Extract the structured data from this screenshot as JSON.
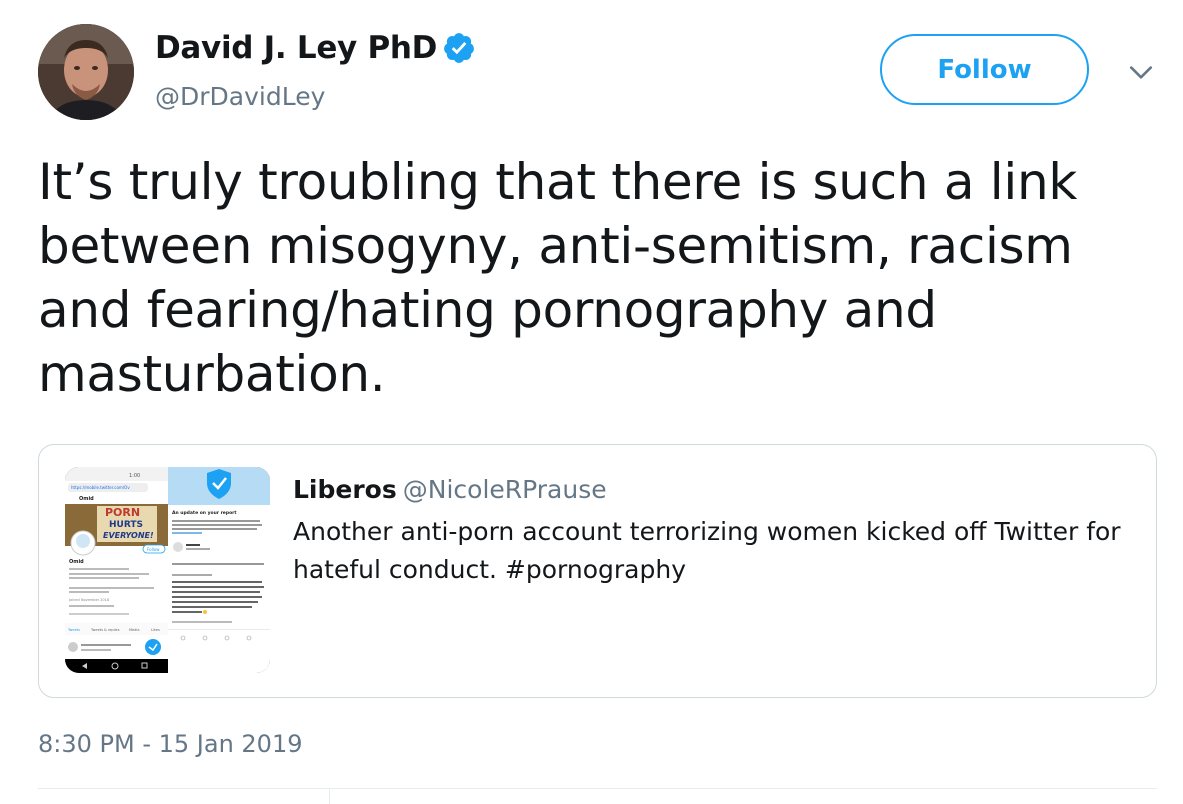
{
  "tweet": {
    "author": {
      "display_name": "David J. Ley PhD",
      "handle": "@DrDavidLey",
      "verified_icon": "verified-badge-icon",
      "avatar_icon": "avatar"
    },
    "follow_label": "Follow",
    "more_icon": "chevron-down-icon",
    "text": "It’s truly troubling that there is such a link between misogyny, anti-semitism, racism and fearing/hating pornography and masturbation.",
    "timestamp": "8:30 PM - 15 Jan 2019"
  },
  "quoted_tweet": {
    "author_name": "Liberos",
    "author_handle": "@NicoleRPrause",
    "text": "Another anti-porn account terrorizing women kicked off Twitter for hateful conduct. #pornography",
    "thumbnail": {
      "left_screen": {
        "status_time": "1:00",
        "url": "https://mobile.twitter.com/Ov",
        "profile_name": "Omid",
        "banner_lines": [
          "PORN",
          "HURTS",
          "EVERYONE!"
        ],
        "follow_label": "Follow",
        "joined": "Joined November 2018",
        "tabs": [
          "Tweets",
          "Tweets & replies",
          "Media",
          "Likes"
        ]
      },
      "right_screen": {
        "heading": "An update on your report",
        "body": "Thanks again for letting us know. Our investigation found this account violated the Twitter Rules:",
        "bullet": "Violating our rules against hateful conduct",
        "quoted": "U know TBH u r not beautiful, even not young even not cute even not sexy even not attractive, so don't be so proud of yourself, no one jerks off because of u, not even me, so just laugh"
      }
    }
  },
  "colors": {
    "accent": "#1da1f2",
    "text": "#14171a",
    "secondary": "#657786",
    "border": "#cfd9de"
  }
}
